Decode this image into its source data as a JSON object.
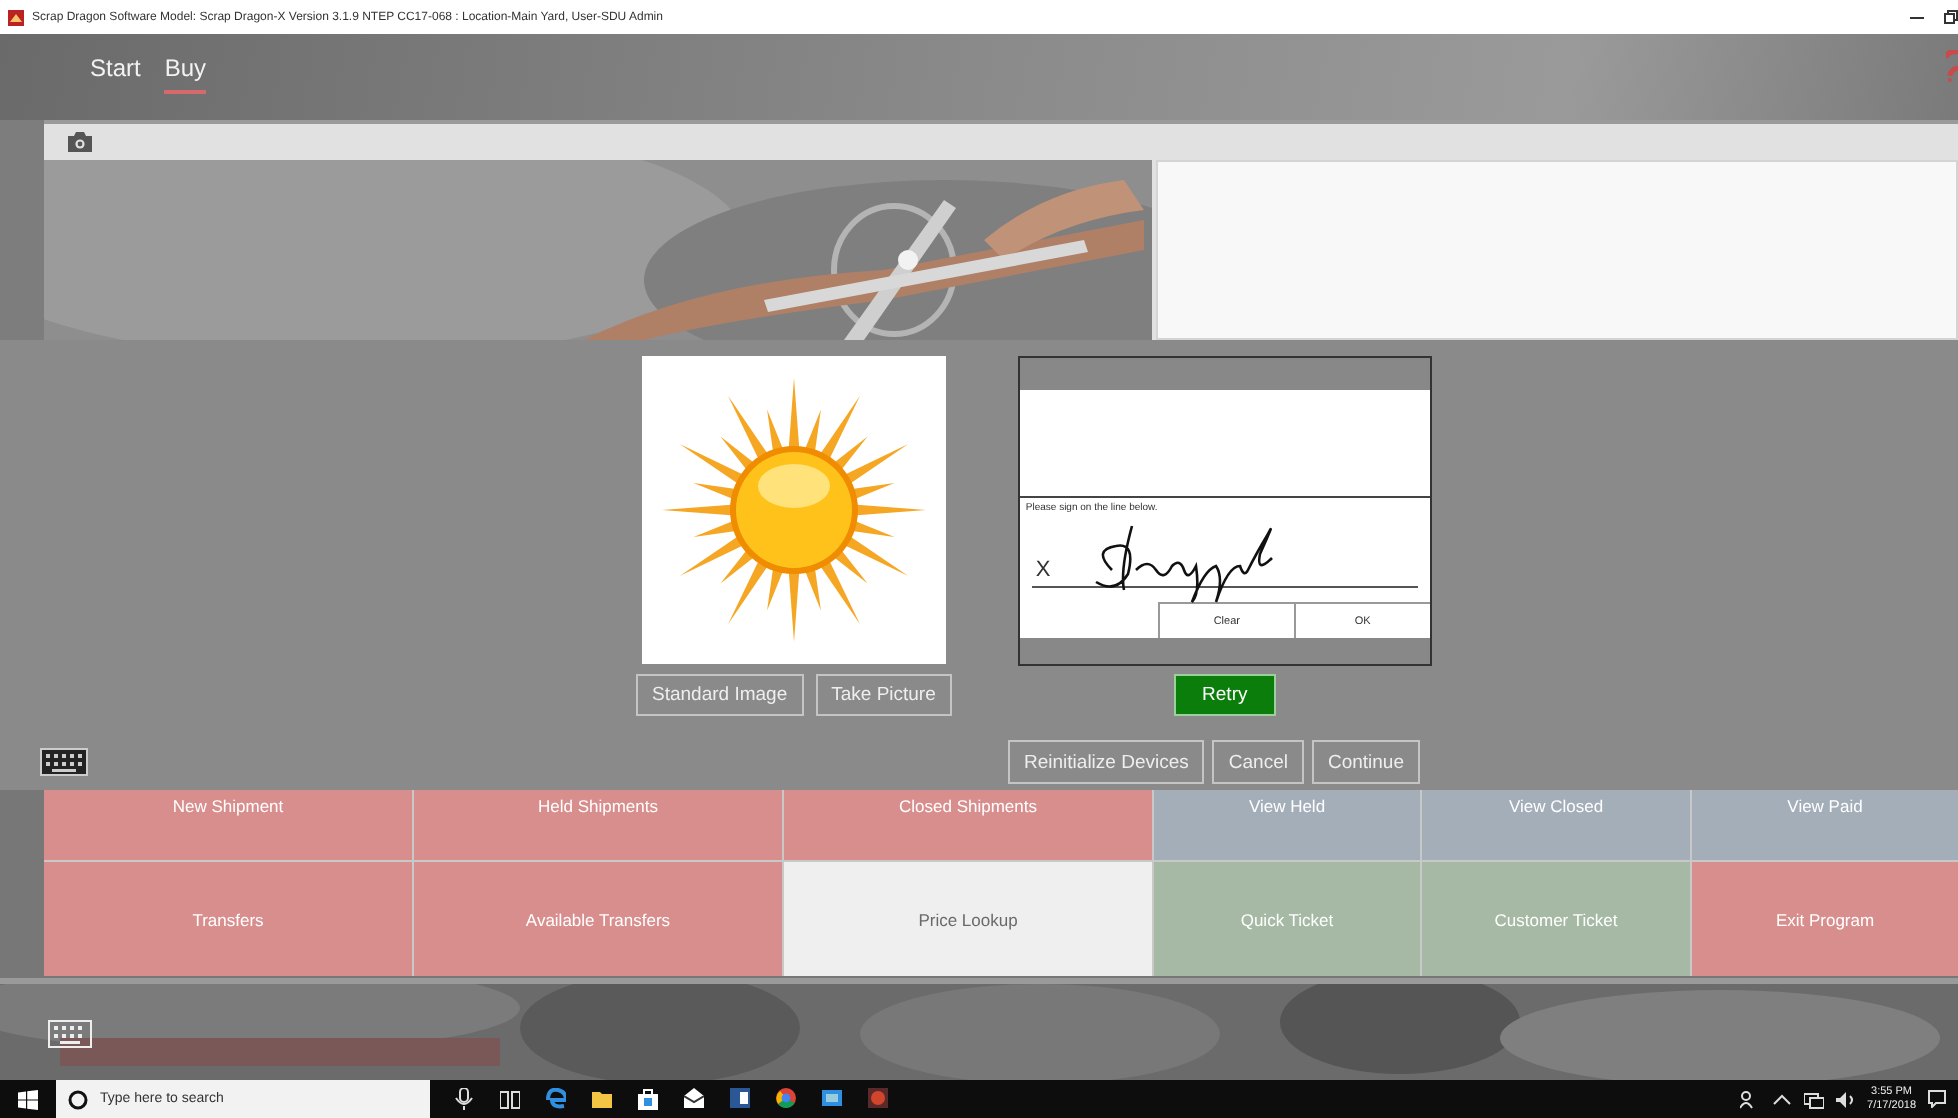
{
  "title_bar": {
    "title": "Scrap Dragon Software Model: Scrap Dragon-X Version 3.1.9 NTEP CC17-068 : Location-Main Yard, User-SDU Admin"
  },
  "nav_tabs": [
    {
      "label": "Start",
      "selected": false
    },
    {
      "label": "Buy",
      "selected": true
    }
  ],
  "dialog": {
    "image_buttons": [
      "Standard Image",
      "Take Picture"
    ],
    "signature_pad": {
      "prompt": "Please sign on the line below.",
      "x_mark": "X",
      "buttons": [
        "Clear",
        "OK"
      ]
    },
    "retry_button": "Retry",
    "buttons": [
      "Reinitialize Devices",
      "Cancel",
      "Continue"
    ]
  },
  "tiles": [
    {
      "label": "New Shipment",
      "color": "#d98e8e"
    },
    {
      "label": "Held Shipments",
      "color": "#d98e8e"
    },
    {
      "label": "Closed Shipments",
      "color": "#d98e8e"
    },
    {
      "label": "View Held",
      "color": "#a4aeb9"
    },
    {
      "label": "View Closed",
      "color": "#a4aeb9"
    },
    {
      "label": "View Paid",
      "color": "#a4aeb9"
    },
    {
      "label": "Transfers",
      "color": "#d98e8e"
    },
    {
      "label": "Available Transfers",
      "color": "#d98e8e"
    },
    {
      "label": "Price Lookup",
      "color": "#efefef"
    },
    {
      "label": "Quick Ticket",
      "color": "#a5b9a4"
    },
    {
      "label": "Customer Ticket",
      "color": "#a5b9a4"
    },
    {
      "label": "Exit Program",
      "color": "#d98e8e"
    }
  ],
  "taskbar": {
    "search": {
      "placeholder": "Type here to search"
    },
    "time": "3:55 PM",
    "date": "7/17/2018"
  }
}
